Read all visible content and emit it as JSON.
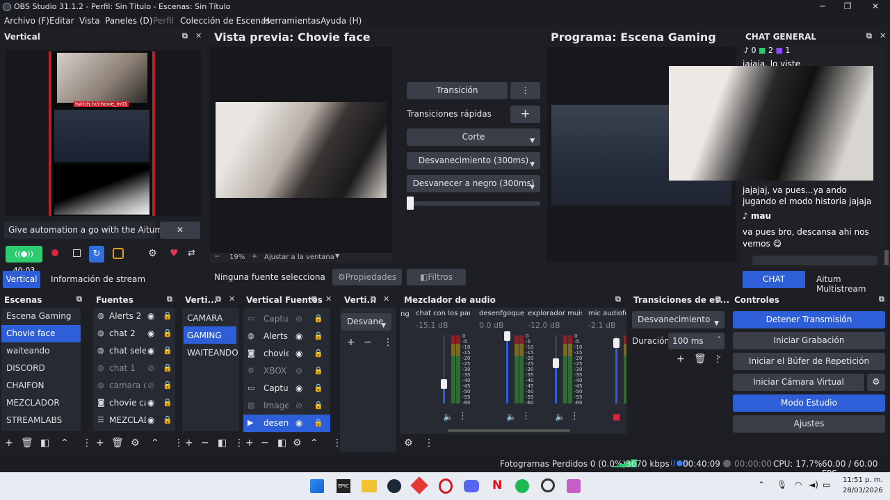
{
  "titlebar": {
    "title": "OBS Studio 31.1.2 - Perfil: Sin Título - Escenas: Sin Título",
    "min": "─",
    "max": "❐",
    "close": "✕"
  },
  "menu": [
    {
      "label": "Archivo (F)"
    },
    {
      "label": "Editar"
    },
    {
      "label": "Vista"
    },
    {
      "label": "Paneles (D)"
    },
    {
      "label": "Perfil"
    },
    {
      "label": "Colección de Escenas"
    },
    {
      "label": "Herramientas"
    },
    {
      "label": "Ayuda (H)"
    }
  ],
  "vertical_dock": {
    "title": "Vertical",
    "overlay_text": "twitch.tv/chovie_m01",
    "notice": "Give automation a go with the Aitum App",
    "timer": "40:03",
    "tab_vertical": "Vertical",
    "tab_info": "Información de stream"
  },
  "preview": {
    "title": "Vista previa: Chovie face",
    "zoom": "19%",
    "fit": "Ajustar a la ventana",
    "no_source": "Ninguna fuente selecciona",
    "props": "Propiedades",
    "filters": "Filtros"
  },
  "transitions_mid": {
    "transition_btn": "Transición",
    "quick": "Transiciones rápidas",
    "opt1": "Corte",
    "opt2": "Desvanecimiento (300ms)",
    "opt3": "Desvanecer a negro (300ms)"
  },
  "program": {
    "title": "Programa: Escena Gaming"
  },
  "chat": {
    "title": "CHAT GENERAL",
    "count_tiktok": "0",
    "count_kick": "2",
    "count_twitch": "1",
    "msg1": "jajaja, lo viste",
    "msg2": "jajajaj, va pues...ya ando jugando el modo historia jajaja",
    "user3": "mau",
    "msg3": "va pues bro, descansa ahi nos vemos 😋",
    "tab_chat": "CHAT GENERAL",
    "tab_multi": "Aitum Multistream"
  },
  "scenes": {
    "title": "Escenas",
    "items": [
      "Escena Gaming",
      "Chovie face",
      "waiteando",
      "DISCORD",
      "CHAIFON",
      "MEZCLADOR",
      "STREAMLABS"
    ]
  },
  "sources": {
    "title": "Fuentes",
    "items": [
      "Alerts 2",
      "chat 2",
      "chat selec",
      "chat 1",
      "camara ch",
      "chovie car",
      "MEZCLAD"
    ]
  },
  "vscenes": {
    "title": "Verti...",
    "items": [
      "CAMARA",
      "GAMING",
      "WAITEANDO"
    ]
  },
  "vsources": {
    "title": "Vertical Fuentes",
    "items": [
      "Captur",
      "Alerts 2",
      "chovie",
      "XBOX",
      "Captur",
      "Imager",
      "desenf"
    ]
  },
  "vtrans": {
    "title": "Verti...",
    "select": "Desvane"
  },
  "mixer": {
    "title": "Mezclador de audio",
    "cut_label": "ng",
    "channels": [
      {
        "name": "chat con los panas",
        "db": "-15.1 dB",
        "level": 0.3
      },
      {
        "name": "desenfgoque",
        "db": "0.0 dB",
        "level": 1.0
      },
      {
        "name": "explorador muisc",
        "db": "-12.0 dB",
        "level": 0.6
      },
      {
        "name": "mic audiofonc",
        "db": "-2.1 dB",
        "level": 0.9
      }
    ],
    "scale": [
      "0",
      "-5",
      "-10",
      "-15",
      "-20",
      "-25",
      "-30",
      "-35",
      "-40",
      "-45",
      "-50",
      "-55",
      "-60"
    ]
  },
  "scene_trans": {
    "title": "Transiciones de es...",
    "select": "Desvanecimiento",
    "dur_label": "Duración",
    "dur_value": "100 ms"
  },
  "controls": {
    "title": "Controles",
    "buttons": [
      "Detener Transmisión",
      "Iniciar Grabación",
      "Iniciar el Búfer de Repetición",
      "Iniciar Cámara Virtual",
      "Modo Estudio",
      "Ajustes"
    ]
  },
  "status": {
    "dropped": "Fotogramas Perdidos 0 (0.0%)",
    "kbps": "3670 kbps",
    "live": "00:40:09",
    "rec": "00:00:00",
    "cpu": "CPU: 17.7%",
    "fps": "60.00 / 60.00 FPS"
  },
  "taskbar": {
    "time": "11:51 p. m.",
    "date": "28/03/2026"
  },
  "colors": {
    "accent": "#2f5fd8",
    "live_green": "#2ecc71"
  }
}
